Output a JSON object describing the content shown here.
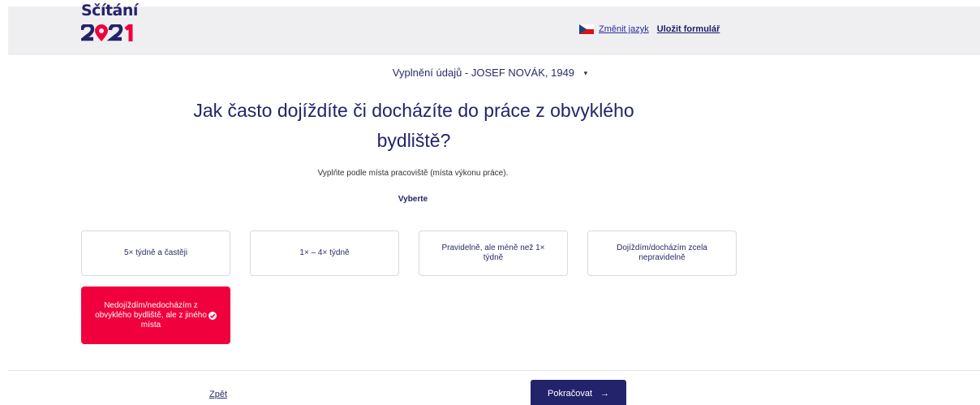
{
  "header": {
    "logo_text": "Sčítání",
    "logo_year": "2021",
    "change_language": "Změnit jazyk",
    "save_form": "Uložit formulář"
  },
  "person_selector": {
    "label": "Vyplnění údajů - JOSEF NOVÁK, 1949",
    "caret": "▾"
  },
  "question": {
    "title": "Jak často dojíždíte či docházíte do práce z obvyklého bydliště?",
    "hint": "Vyplňte podle místa pracoviště (místa výkonu práce).",
    "choose_label": "Vyberte"
  },
  "options": [
    {
      "label": "5× týdně a častěji",
      "selected": false
    },
    {
      "label": "1× – 4× týdně",
      "selected": false
    },
    {
      "label": "Pravidelně, ale méně než 1× týdně",
      "selected": false
    },
    {
      "label": "Dojíždím/docházím zcela nepravidelně",
      "selected": false
    },
    {
      "label": "Nedojíždím/nedocházím z obvyklého bydliště, ale z jiného místa",
      "selected": true
    }
  ],
  "footer": {
    "back": "Zpět",
    "next": "Pokračovat",
    "next_arrow": "→"
  },
  "colors": {
    "primary": "#23236b",
    "selected": "#f0003c",
    "header_bg": "#efeff1"
  }
}
